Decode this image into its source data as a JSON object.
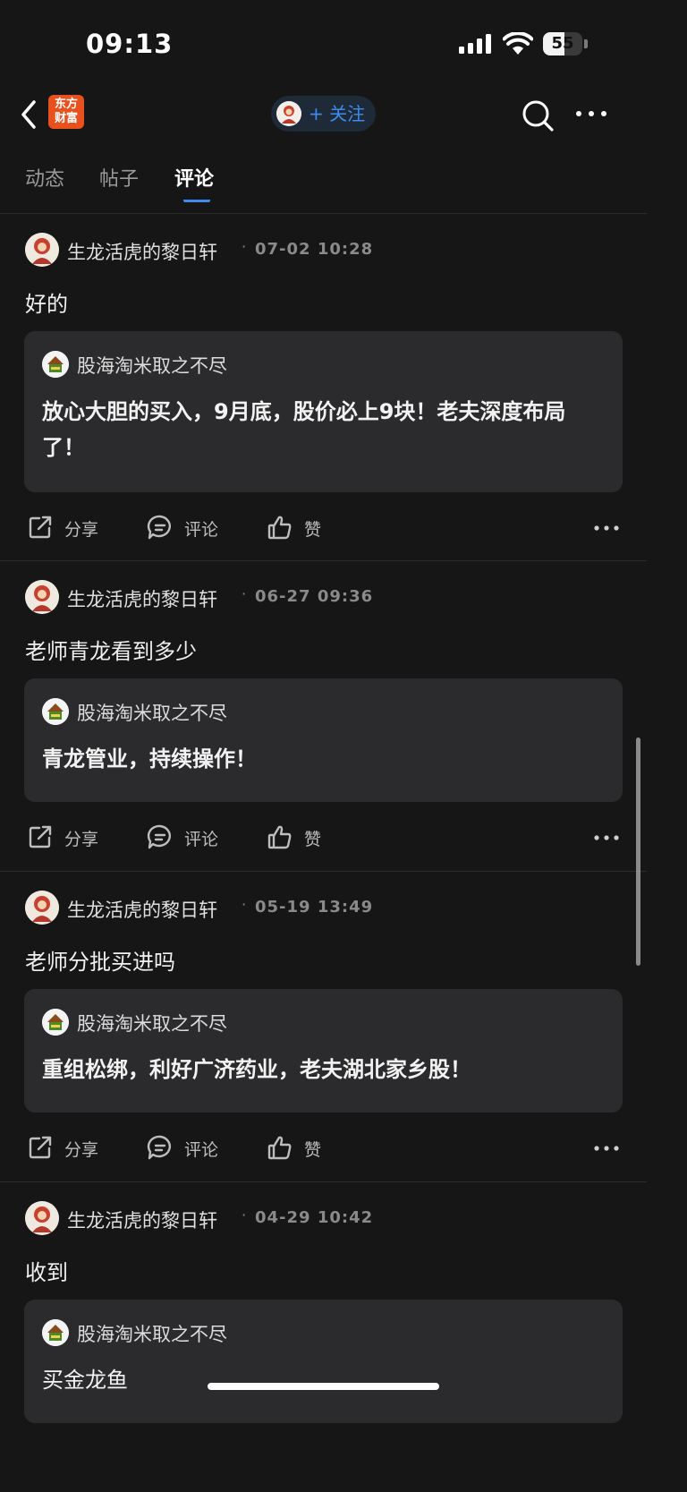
{
  "status_bar": {
    "time": "09:13",
    "battery": "55",
    "battery_level": 0.55
  },
  "navbar": {
    "back_icon": "chevron-left-icon",
    "logo_text_line1": "东方",
    "logo_text_line2": "财富",
    "follow_label": "+ 关注",
    "search_icon": "search-icon",
    "more_icon": "more-dots-icon"
  },
  "tabs": [
    {
      "label": "动态",
      "active": false
    },
    {
      "label": "帖子",
      "active": false
    },
    {
      "label": "评论",
      "active": true
    }
  ],
  "actions": {
    "share": "分享",
    "comment": "评论",
    "like": "赞"
  },
  "posts": [
    {
      "username": "生龙活虎的黎日轩",
      "separator": "·",
      "time": "07-02 10:28",
      "comment": "好的",
      "quote": {
        "username": "股海淘米取之不尽",
        "text": "放心大胆的买入，9月底，股价必上9块！老夫深度布局了！"
      }
    },
    {
      "username": "生龙活虎的黎日轩",
      "separator": "·",
      "time": "06-27 09:36",
      "comment": "老师青龙看到多少",
      "quote": {
        "username": "股海淘米取之不尽",
        "text": "青龙管业，持续操作！"
      }
    },
    {
      "username": "生龙活虎的黎日轩",
      "separator": "·",
      "time": "05-19 13:49",
      "comment": "老师分批买进吗",
      "quote": {
        "username": "股海淘米取之不尽",
        "text": "重组松绑，利好广济药业，老夫湖北家乡股！"
      }
    },
    {
      "username": "生龙活虎的黎日轩",
      "separator": "·",
      "time": "04-29 10:42",
      "comment": "收到",
      "quote": {
        "username": "股海淘米取之不尽",
        "text": "买金龙鱼"
      }
    }
  ],
  "colors": {
    "background": "#161616",
    "accent": "#3c8cf0",
    "card": "#2b2b2d",
    "logo": "#e8501e"
  }
}
